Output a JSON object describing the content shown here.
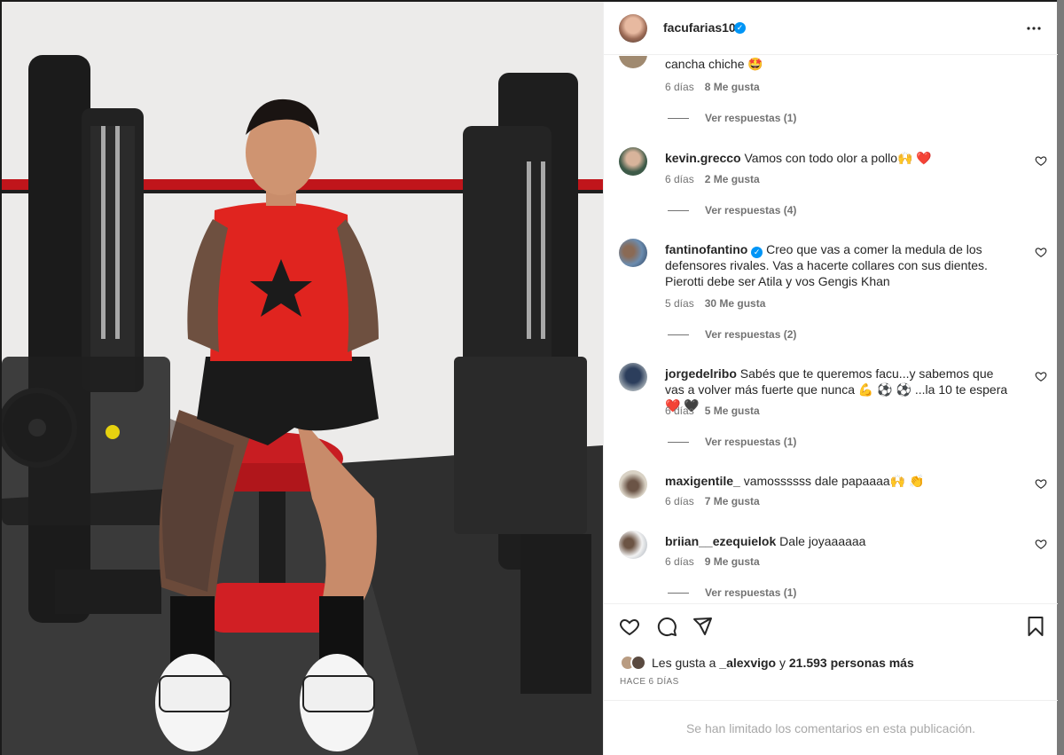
{
  "post": {
    "author": "facufarias10",
    "author_verified": true,
    "photo_alt": "Jugador con camiseta roja sentado en máquina de gimnasio"
  },
  "comments": [
    {
      "username": "",
      "text": "cancha chiche 🤩",
      "time": "6 días",
      "likes": "8 Me gusta",
      "replies": "Ver respuestas (1)"
    },
    {
      "username": "kevin.grecco",
      "text": "Vamos con todo olor a pollo🙌 ❤️",
      "time": "6 días",
      "likes": "2 Me gusta",
      "replies": "Ver respuestas (4)"
    },
    {
      "username": "fantinofantino",
      "verified": true,
      "text": "Creo que vas a comer la medula de los defensores rivales. Vas a hacerte collares con sus dientes. Pierotti debe ser Atila y vos Gengis Khan",
      "time": "5 días",
      "likes": "30 Me gusta",
      "replies": "Ver respuestas (2)"
    },
    {
      "username": "jorgedelribo",
      "text": "Sabés que te queremos facu...y sabemos que vas a volver más fuerte que nunca 💪 ⚽ ⚽ ...la 10 te espera ❤️ 🖤",
      "time": "6 días",
      "likes": "5 Me gusta",
      "replies": "Ver respuestas (1)"
    },
    {
      "username": "maxigentile_",
      "text": "vamossssss dale papaaaa🙌 👏",
      "time": "6 días",
      "likes": "7 Me gusta",
      "replies": ""
    },
    {
      "username": "briian__ezequielok",
      "text": "Dale joyaaaaaa",
      "time": "6 días",
      "likes": "9 Me gusta",
      "replies": "Ver respuestas (1)"
    }
  ],
  "footer": {
    "likes_prefix": "Les gusta a ",
    "liked_by": "_alexvigo",
    "likes_middle": " y ",
    "likes_count": "21.593 personas más",
    "time_ago": "HACE 6 DÍAS",
    "limited_notice": "Se han limitado los comentarios en esta publicación."
  },
  "icons": {
    "more": "more-horizontal-icon",
    "like": "heart-icon",
    "comment": "comment-icon",
    "share": "send-icon",
    "save": "bookmark-icon"
  },
  "colors": {
    "text": "#262626",
    "secondary": "#737373",
    "verified": "#0095f6",
    "divider": "#efefef",
    "jersey_red": "#e0241f"
  }
}
